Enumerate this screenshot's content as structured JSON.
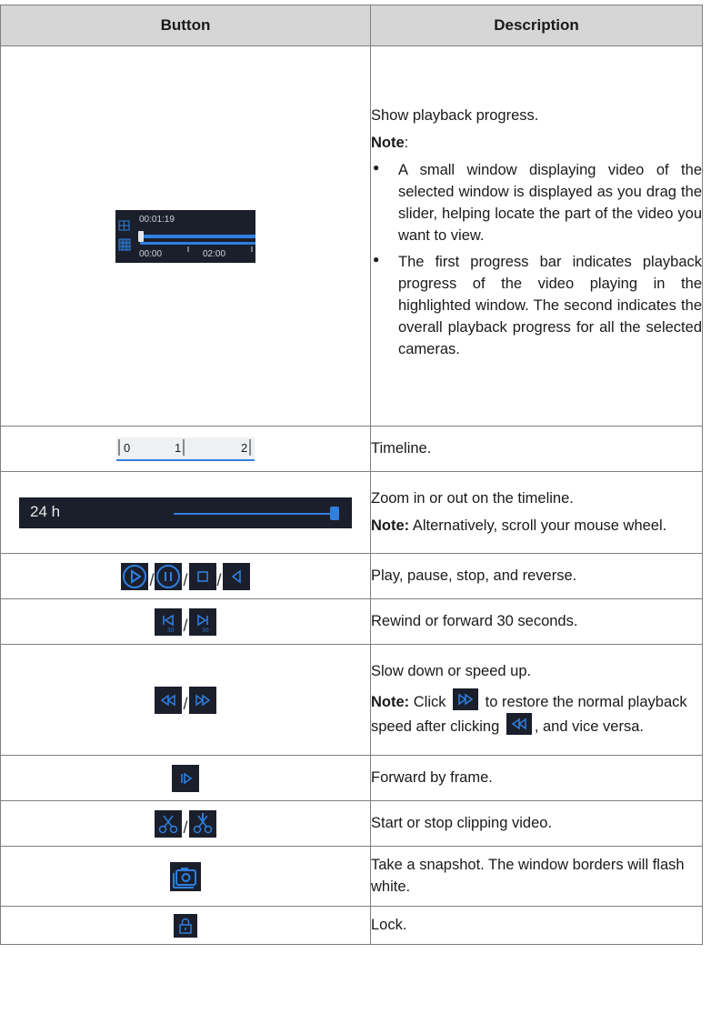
{
  "table": {
    "col_button": "Button",
    "col_description": "Description"
  },
  "rows": {
    "progress": {
      "icon_time": "00:01:19",
      "tick_a": "00:00",
      "tick_b": "02:00",
      "desc": "Show playback progress.",
      "note_label": "Note",
      "note_colon": ":",
      "bullet1": "A small window displaying video of the selected window is displayed as you drag the slider, helping locate the part of the video you want to view.",
      "bullet2": "The first progress bar indicates playback progress of the video playing in the highlighted window. The second indicates the overall playback progress for all the selected cameras."
    },
    "timeline": {
      "tick0": "0",
      "tick1": "1",
      "tick2": "2",
      "desc": "Timeline."
    },
    "zoom": {
      "icon_label": "24 h",
      "desc": "Zoom in or out on the timeline.",
      "note_label": "Note:",
      "note_text": " Alternatively, scroll your mouse wheel."
    },
    "play": {
      "desc": "Play, pause, stop, and reverse."
    },
    "rewind": {
      "desc": "Rewind or forward 30 seconds."
    },
    "speed": {
      "desc": "Slow down or speed up.",
      "note_label": "Note:",
      "note_a": " Click ",
      "note_b": " to restore the normal playback speed after clicking ",
      "note_c": ", and vice versa."
    },
    "frame": {
      "desc": "Forward by frame."
    },
    "clip": {
      "desc": "Start or stop clipping video."
    },
    "snapshot": {
      "desc": "Take a snapshot. The window borders will flash white."
    },
    "lock": {
      "desc": "Lock."
    }
  },
  "separator": "/",
  "colors": {
    "icon_bg": "#1b1f2b",
    "accent": "#2f7fe0",
    "header_bg": "#d6d6d6"
  }
}
